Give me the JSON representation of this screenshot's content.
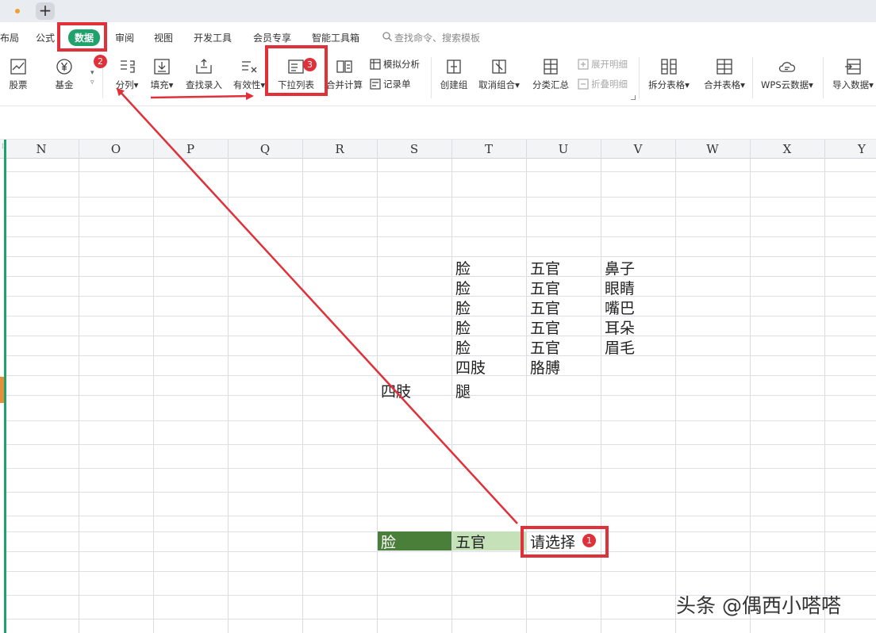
{
  "menu": {
    "tabs": [
      "布局",
      "公式",
      "数据",
      "审阅",
      "视图",
      "开发工具",
      "会员专享",
      "智能工具箱"
    ],
    "search_label": "查找命令、搜索模板"
  },
  "ribbon": {
    "stock": "股票",
    "fund": "基金",
    "split": "分列",
    "fill": "填充",
    "lookup_entry": "查找录入",
    "validity": "有效性",
    "dropdown_list": "下拉列表",
    "merge_calc": "合并计算",
    "simulate": "模拟分析",
    "record": "记录单",
    "create_group": "创建组",
    "ungroup": "取消组合",
    "subtotal": "分类汇总",
    "expand_detail": "展开明细",
    "collapse_detail": "折叠明细",
    "split_table": "拆分表格",
    "merge_table": "合并表格",
    "wps_cloud": "WPS云数据",
    "import_data": "导入数据"
  },
  "columns": [
    "N",
    "O",
    "P",
    "Q",
    "R",
    "S",
    "T",
    "U",
    "V",
    "W",
    "X",
    "Y"
  ],
  "table_rows": [
    [
      "",
      "脸",
      "五官",
      "鼻子"
    ],
    [
      "",
      "脸",
      "五官",
      "眼睛"
    ],
    [
      "",
      "脸",
      "五官",
      "嘴巴"
    ],
    [
      "",
      "脸",
      "五官",
      "耳朵"
    ],
    [
      "",
      "脸",
      "五官",
      "眉毛"
    ],
    [
      "",
      "四肢",
      "胳膊",
      ""
    ],
    [
      "四肢",
      "腿",
      "",
      ""
    ]
  ],
  "selection_row": {
    "s": "脸",
    "t": "五官",
    "u": "请选择"
  },
  "badges": [
    "1",
    "2",
    "3"
  ],
  "watermark": "头条 @偶西小嗒嗒",
  "colors": {
    "accent_green": "#1fa26b",
    "dark_green_cell": "#4a7f3a",
    "light_green_cell": "#c4e1b8",
    "annotation_red": "#e0303a"
  }
}
